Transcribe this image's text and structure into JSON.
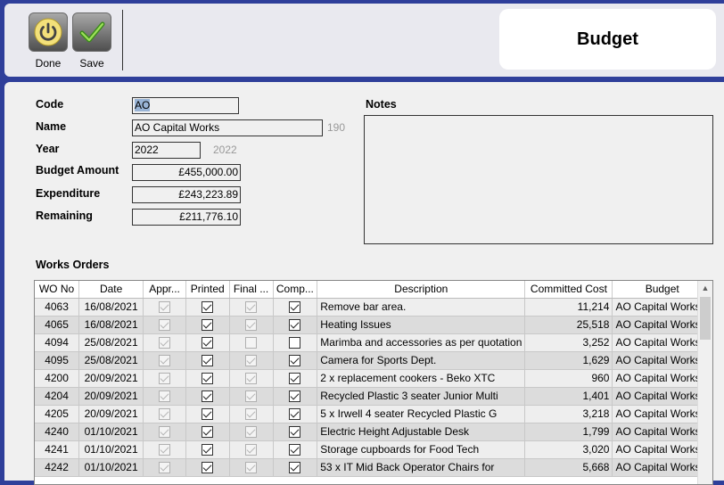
{
  "toolbar": {
    "done_label": "Done",
    "save_label": "Save",
    "title": "Budget"
  },
  "form": {
    "code_label": "Code",
    "code_value": "AO",
    "name_label": "Name",
    "name_value": "AO Capital Works",
    "name_hint": "190",
    "year_label": "Year",
    "year_value": "2022",
    "year_hint": "2022",
    "budget_label": "Budget Amount",
    "budget_value": "£455,000.00",
    "expenditure_label": "Expenditure",
    "expenditure_value": "£243,223.89",
    "remaining_label": "Remaining",
    "remaining_value": "£211,776.10"
  },
  "notes": {
    "label": "Notes",
    "value": ""
  },
  "works_orders": {
    "label": "Works Orders",
    "columns": [
      "WO No",
      "Date",
      "Appr...",
      "Printed",
      "Final ...",
      "Comp...",
      "Description",
      "Committed Cost",
      "Budget"
    ],
    "rows": [
      {
        "wo": "4063",
        "date": "16/08/2021",
        "appr": true,
        "printed": true,
        "final": true,
        "comp": true,
        "desc": "Remove bar area.",
        "cost": "11,214",
        "budget": "AO Capital Works"
      },
      {
        "wo": "4065",
        "date": "16/08/2021",
        "appr": true,
        "printed": true,
        "final": true,
        "comp": true,
        "desc": "Heating Issues",
        "cost": "25,518",
        "budget": "AO Capital Works"
      },
      {
        "wo": "4094",
        "date": "25/08/2021",
        "appr": true,
        "printed": true,
        "final": false,
        "comp": false,
        "desc": "Marimba and accessories as per quotation",
        "cost": "3,252",
        "budget": "AO Capital Works"
      },
      {
        "wo": "4095",
        "date": "25/08/2021",
        "appr": true,
        "printed": true,
        "final": true,
        "comp": true,
        "desc": "Camera for Sports Dept.",
        "cost": "1,629",
        "budget": "AO Capital Works"
      },
      {
        "wo": "4200",
        "date": "20/09/2021",
        "appr": true,
        "printed": true,
        "final": true,
        "comp": true,
        "desc": "2 x replacement cookers - Beko XTC",
        "cost": "960",
        "budget": "AO Capital Works"
      },
      {
        "wo": "4204",
        "date": "20/09/2021",
        "appr": true,
        "printed": true,
        "final": true,
        "comp": true,
        "desc": "Recycled Plastic 3 seater Junior Multi",
        "cost": "1,401",
        "budget": "AO Capital Works"
      },
      {
        "wo": "4205",
        "date": "20/09/2021",
        "appr": true,
        "printed": true,
        "final": true,
        "comp": true,
        "desc": "5 x Irwell 4 seater Recycled Plastic G",
        "cost": "3,218",
        "budget": "AO Capital Works"
      },
      {
        "wo": "4240",
        "date": "01/10/2021",
        "appr": true,
        "printed": true,
        "final": true,
        "comp": true,
        "desc": "Electric Height Adjustable Desk",
        "cost": "1,799",
        "budget": "AO Capital Works"
      },
      {
        "wo": "4241",
        "date": "01/10/2021",
        "appr": true,
        "printed": true,
        "final": true,
        "comp": true,
        "desc": "Storage cupboards for Food Tech",
        "cost": "3,020",
        "budget": "AO Capital Works"
      },
      {
        "wo": "4242",
        "date": "01/10/2021",
        "appr": true,
        "printed": true,
        "final": true,
        "comp": true,
        "desc": "53 x IT Mid Back Operator Chairs for",
        "cost": "5,668",
        "budget": "AO Capital Works"
      }
    ]
  },
  "icons": {
    "done": "power-icon",
    "save": "checkmark-icon"
  },
  "colors": {
    "frame": "#2f3f9a",
    "selection": "#99b4d6"
  }
}
